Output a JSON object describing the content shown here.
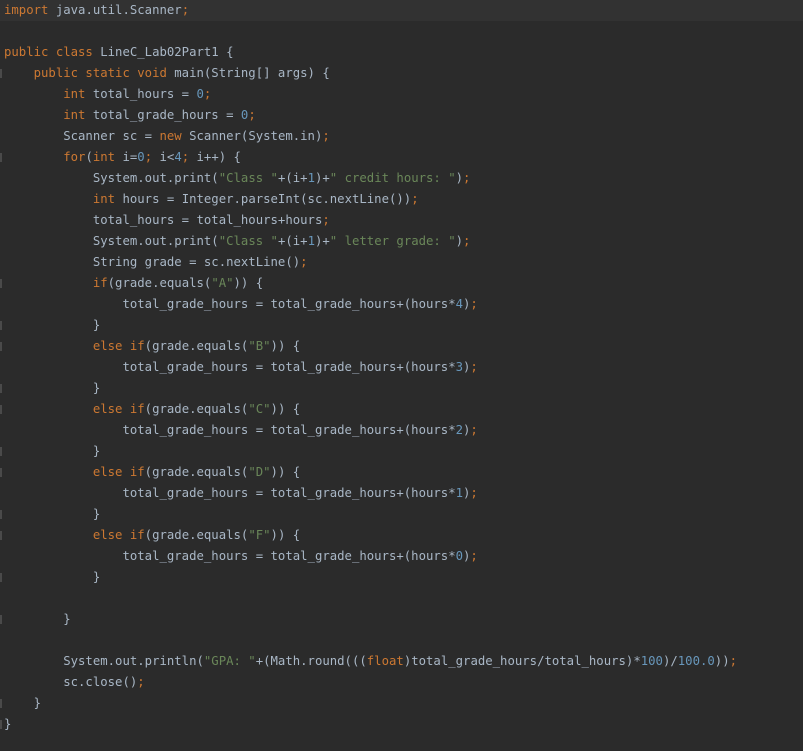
{
  "editor": {
    "language": "java",
    "file_class": "LineC_Lab02Part1",
    "colors": {
      "background": "#2b2b2b",
      "highlight_line": "#323232",
      "keyword": "#cc7832",
      "string": "#6a8759",
      "number": "#6897bb",
      "identifier": "#a9b7c6"
    },
    "lines": [
      [
        {
          "t": "kw",
          "v": "import"
        },
        {
          "t": "id",
          "v": " java.util.Scanner"
        },
        {
          "t": "kw",
          "v": ";"
        }
      ],
      [],
      [
        {
          "t": "kw",
          "v": "public class"
        },
        {
          "t": "id",
          "v": " LineC_Lab02Part1 {"
        }
      ],
      [
        {
          "t": "kw",
          "v": "    public static void"
        },
        {
          "t": "id",
          "v": " main(String[] args) {"
        }
      ],
      [
        {
          "t": "kw",
          "v": "        int"
        },
        {
          "t": "id",
          "v": " total_hours = "
        },
        {
          "t": "num",
          "v": "0"
        },
        {
          "t": "kw",
          "v": ";"
        }
      ],
      [
        {
          "t": "kw",
          "v": "        int"
        },
        {
          "t": "id",
          "v": " total_grade_hours = "
        },
        {
          "t": "num",
          "v": "0"
        },
        {
          "t": "kw",
          "v": ";"
        }
      ],
      [
        {
          "t": "id",
          "v": "        Scanner sc = "
        },
        {
          "t": "kw",
          "v": "new"
        },
        {
          "t": "id",
          "v": " Scanner(System.in)"
        },
        {
          "t": "kw",
          "v": ";"
        }
      ],
      [
        {
          "t": "kw",
          "v": "        for"
        },
        {
          "t": "id",
          "v": "("
        },
        {
          "t": "kw",
          "v": "int"
        },
        {
          "t": "id",
          "v": " i="
        },
        {
          "t": "num",
          "v": "0"
        },
        {
          "t": "kw",
          "v": ";"
        },
        {
          "t": "id",
          "v": " i<"
        },
        {
          "t": "num",
          "v": "4"
        },
        {
          "t": "kw",
          "v": ";"
        },
        {
          "t": "id",
          "v": " i++) {"
        }
      ],
      [
        {
          "t": "id",
          "v": "            System.out.print("
        },
        {
          "t": "str",
          "v": "\"Class \""
        },
        {
          "t": "id",
          "v": "+(i+"
        },
        {
          "t": "num",
          "v": "1"
        },
        {
          "t": "id",
          "v": ")+"
        },
        {
          "t": "str",
          "v": "\" credit hours: \""
        },
        {
          "t": "id",
          "v": ")"
        },
        {
          "t": "kw",
          "v": ";"
        }
      ],
      [
        {
          "t": "kw",
          "v": "            int"
        },
        {
          "t": "id",
          "v": " hours = Integer.parseInt(sc.nextLine())"
        },
        {
          "t": "kw",
          "v": ";"
        }
      ],
      [
        {
          "t": "id",
          "v": "            total_hours = total_hours+hours"
        },
        {
          "t": "kw",
          "v": ";"
        }
      ],
      [
        {
          "t": "id",
          "v": "            System.out.print("
        },
        {
          "t": "str",
          "v": "\"Class \""
        },
        {
          "t": "id",
          "v": "+(i+"
        },
        {
          "t": "num",
          "v": "1"
        },
        {
          "t": "id",
          "v": ")+"
        },
        {
          "t": "str",
          "v": "\" letter grade: \""
        },
        {
          "t": "id",
          "v": ")"
        },
        {
          "t": "kw",
          "v": ";"
        }
      ],
      [
        {
          "t": "id",
          "v": "            String grade = sc.nextLine()"
        },
        {
          "t": "kw",
          "v": ";"
        }
      ],
      [
        {
          "t": "kw",
          "v": "            if"
        },
        {
          "t": "id",
          "v": "(grade.equals("
        },
        {
          "t": "str",
          "v": "\"A\""
        },
        {
          "t": "id",
          "v": ")) {"
        }
      ],
      [
        {
          "t": "id",
          "v": "                total_grade_hours = total_grade_hours+(hours*"
        },
        {
          "t": "num",
          "v": "4"
        },
        {
          "t": "id",
          "v": ")"
        },
        {
          "t": "kw",
          "v": ";"
        }
      ],
      [
        {
          "t": "id",
          "v": "            }"
        }
      ],
      [
        {
          "t": "kw",
          "v": "            else if"
        },
        {
          "t": "id",
          "v": "(grade.equals("
        },
        {
          "t": "str",
          "v": "\"B\""
        },
        {
          "t": "id",
          "v": ")) {"
        }
      ],
      [
        {
          "t": "id",
          "v": "                total_grade_hours = total_grade_hours+(hours*"
        },
        {
          "t": "num",
          "v": "3"
        },
        {
          "t": "id",
          "v": ")"
        },
        {
          "t": "kw",
          "v": ";"
        }
      ],
      [
        {
          "t": "id",
          "v": "            }"
        }
      ],
      [
        {
          "t": "kw",
          "v": "            else if"
        },
        {
          "t": "id",
          "v": "(grade.equals("
        },
        {
          "t": "str",
          "v": "\"C\""
        },
        {
          "t": "id",
          "v": ")) {"
        }
      ],
      [
        {
          "t": "id",
          "v": "                total_grade_hours = total_grade_hours+(hours*"
        },
        {
          "t": "num",
          "v": "2"
        },
        {
          "t": "id",
          "v": ")"
        },
        {
          "t": "kw",
          "v": ";"
        }
      ],
      [
        {
          "t": "id",
          "v": "            }"
        }
      ],
      [
        {
          "t": "kw",
          "v": "            else if"
        },
        {
          "t": "id",
          "v": "(grade.equals("
        },
        {
          "t": "str",
          "v": "\"D\""
        },
        {
          "t": "id",
          "v": ")) {"
        }
      ],
      [
        {
          "t": "id",
          "v": "                total_grade_hours = total_grade_hours+(hours*"
        },
        {
          "t": "num",
          "v": "1"
        },
        {
          "t": "id",
          "v": ")"
        },
        {
          "t": "kw",
          "v": ";"
        }
      ],
      [
        {
          "t": "id",
          "v": "            }"
        }
      ],
      [
        {
          "t": "kw",
          "v": "            else if"
        },
        {
          "t": "id",
          "v": "(grade.equals("
        },
        {
          "t": "str",
          "v": "\"F\""
        },
        {
          "t": "id",
          "v": ")) {"
        }
      ],
      [
        {
          "t": "id",
          "v": "                total_grade_hours = total_grade_hours+(hours*"
        },
        {
          "t": "num",
          "v": "0"
        },
        {
          "t": "id",
          "v": ")"
        },
        {
          "t": "kw",
          "v": ";"
        }
      ],
      [
        {
          "t": "id",
          "v": "            }"
        }
      ],
      [],
      [
        {
          "t": "id",
          "v": "        }"
        }
      ],
      [],
      [
        {
          "t": "id",
          "v": "        System.out.println("
        },
        {
          "t": "str",
          "v": "\"GPA: \""
        },
        {
          "t": "id",
          "v": "+(Math.round((("
        },
        {
          "t": "kw",
          "v": "float"
        },
        {
          "t": "id",
          "v": ")total_grade_hours/total_hours)*"
        },
        {
          "t": "num",
          "v": "100"
        },
        {
          "t": "id",
          "v": ")/"
        },
        {
          "t": "num",
          "v": "100.0"
        },
        {
          "t": "id",
          "v": "))"
        },
        {
          "t": "kw",
          "v": ";"
        }
      ],
      [
        {
          "t": "id",
          "v": "        sc.close()"
        },
        {
          "t": "kw",
          "v": ";"
        }
      ],
      [
        {
          "t": "id",
          "v": "    }"
        }
      ],
      [
        {
          "t": "id",
          "v": "}"
        }
      ]
    ]
  }
}
